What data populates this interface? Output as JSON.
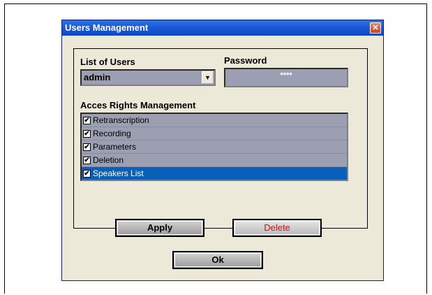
{
  "window": {
    "title": "Users Management",
    "close_glyph": "✕"
  },
  "users": {
    "label": "List of Users",
    "selected": "admin",
    "arrow_glyph": "▼"
  },
  "password": {
    "label": "Password",
    "masked": "****"
  },
  "rights": {
    "label": "Acces Rights Management",
    "items": [
      {
        "label": "Retranscription",
        "checked": true
      },
      {
        "label": "Recording",
        "checked": true
      },
      {
        "label": "Parameters",
        "checked": true
      },
      {
        "label": "Deletion",
        "checked": true
      },
      {
        "label": "Speakers List",
        "checked": true
      }
    ]
  },
  "buttons": {
    "apply": "Apply",
    "delete": "Delete",
    "ok": "Ok"
  },
  "check_glyph": "✔",
  "colors": {
    "titlebar": "#1a57d6",
    "selection": "#0a5fb8",
    "field": "#9c9fb2",
    "delete_text": "#e01010"
  }
}
